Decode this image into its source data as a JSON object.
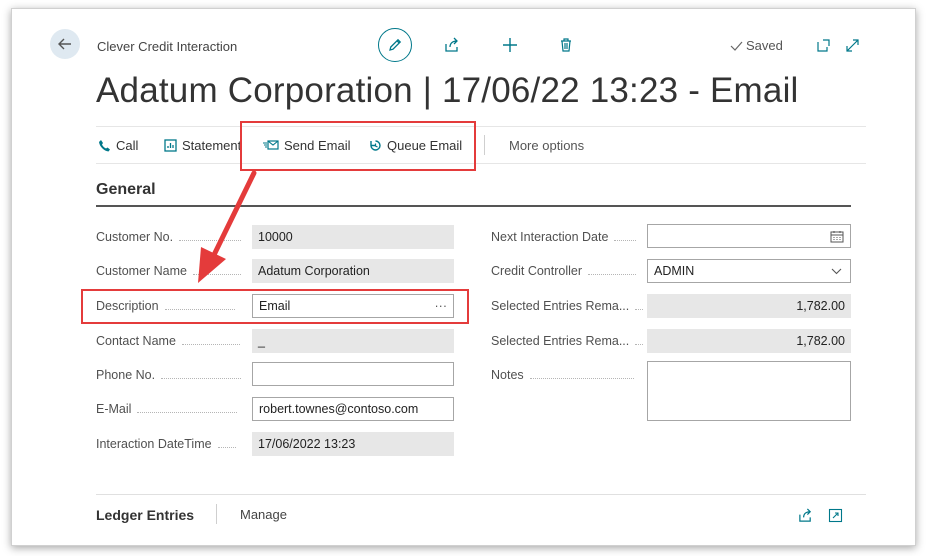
{
  "header": {
    "breadcrumb": "Clever Credit Interaction",
    "title": "Adatum Corporation | 17/06/22 13:23 - Email",
    "saved_label": "Saved"
  },
  "actions": {
    "call": "Call",
    "statement": "Statement",
    "send_email": "Send Email",
    "queue_email": "Queue Email",
    "more_options": "More options"
  },
  "section": {
    "title": "General"
  },
  "left_fields": {
    "customer_no": {
      "label": "Customer No.",
      "value": "10000"
    },
    "customer_name": {
      "label": "Customer Name",
      "value": "Adatum Corporation"
    },
    "description": {
      "label": "Description",
      "value": "Email",
      "more": "···"
    },
    "contact_name": {
      "label": "Contact Name",
      "value": "_"
    },
    "phone_no": {
      "label": "Phone No.",
      "value": ""
    },
    "email": {
      "label": "E-Mail",
      "value": "robert.townes@contoso.com"
    },
    "interaction_datetime": {
      "label": "Interaction DateTime",
      "value": "17/06/2022 13:23"
    }
  },
  "right_fields": {
    "next_interaction_date": {
      "label": "Next Interaction Date",
      "value": ""
    },
    "credit_controller": {
      "label": "Credit Controller",
      "value": "ADMIN"
    },
    "selected_entries_1": {
      "label": "Selected Entries Rema...",
      "value": "1,782.00"
    },
    "selected_entries_2": {
      "label": "Selected Entries Rema...",
      "value": "1,782.00"
    },
    "notes": {
      "label": "Notes",
      "value": ""
    }
  },
  "bottom": {
    "ledger_entries": "Ledger Entries",
    "manage": "Manage"
  },
  "colors": {
    "accent": "#00788a",
    "highlight": "#e43b3b",
    "readonly_bg": "#e7e7e7"
  },
  "icons": [
    "back-arrow-icon",
    "edit-pencil-icon",
    "share-icon",
    "plus-icon",
    "delete-icon",
    "check-icon",
    "popout-icon",
    "expand-icon",
    "phone-icon",
    "statement-icon",
    "send-email-icon",
    "queue-email-icon",
    "calendar-icon",
    "chevron-down-icon"
  ]
}
